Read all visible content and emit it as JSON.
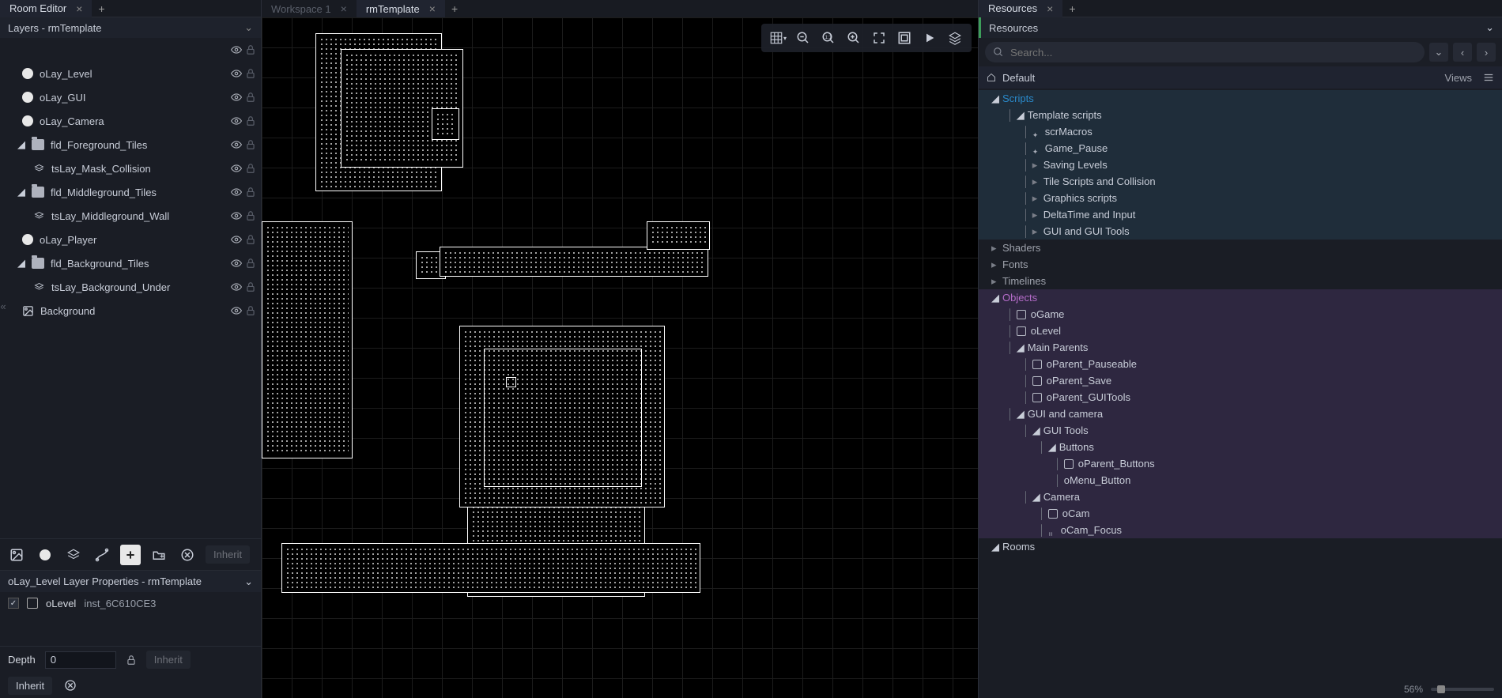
{
  "leftPanel": {
    "tab": "Room Editor",
    "layersHeader": "Layers - rmTemplate",
    "layers": [
      {
        "name": "",
        "type": "header-eye",
        "indent": 0
      },
      {
        "name": "oLay_Level",
        "type": "circle",
        "indent": 0
      },
      {
        "name": "oLay_GUI",
        "type": "circle",
        "indent": 0
      },
      {
        "name": "oLay_Camera",
        "type": "circle",
        "indent": 0
      },
      {
        "name": "fld_Foreground_Tiles",
        "type": "folder",
        "indent": 1,
        "open": true
      },
      {
        "name": "tsLay_Mask_Collision",
        "type": "tile",
        "indent": 2
      },
      {
        "name": "fld_Middleground_Tiles",
        "type": "folder",
        "indent": 1,
        "open": true
      },
      {
        "name": "tsLay_Middleground_Wall",
        "type": "tile",
        "indent": 2
      },
      {
        "name": "oLay_Player",
        "type": "circle",
        "indent": 0
      },
      {
        "name": "fld_Background_Tiles",
        "type": "folder",
        "indent": 1,
        "open": true
      },
      {
        "name": "tsLay_Background_Under",
        "type": "tile",
        "indent": 2
      },
      {
        "name": "Background",
        "type": "bg",
        "indent": 0
      }
    ],
    "inheritLabel": "Inherit",
    "propsHeader": "oLay_Level Layer Properties - rmTemplate",
    "instance": {
      "obj": "oLevel",
      "id": "inst_6C610CE3"
    },
    "depthLabel": "Depth",
    "depthValue": "0"
  },
  "center": {
    "tabs": [
      {
        "label": "Workspace 1",
        "active": false
      },
      {
        "label": "rmTemplate",
        "active": true
      }
    ]
  },
  "rightPanel": {
    "tab": "Resources",
    "header": "Resources",
    "searchPlaceholder": "Search...",
    "defaultLabel": "Default",
    "viewsLabel": "Views",
    "zoom": "56%",
    "tree": [
      {
        "t": "cat",
        "label": "Scripts",
        "cls": "scripts",
        "open": true,
        "indent": 0
      },
      {
        "t": "folder",
        "label": "Template scripts",
        "cls": "scripts",
        "open": true,
        "indent": 1
      },
      {
        "t": "script",
        "label": "scrMacros",
        "cls": "scripts",
        "indent": 2
      },
      {
        "t": "script",
        "label": "Game_Pause",
        "cls": "scripts",
        "indent": 2
      },
      {
        "t": "folder",
        "label": "Saving Levels",
        "cls": "scripts",
        "open": false,
        "indent": 2
      },
      {
        "t": "folder",
        "label": "Tile Scripts and Collision",
        "cls": "scripts",
        "open": false,
        "indent": 2
      },
      {
        "t": "folder",
        "label": "Graphics scripts",
        "cls": "scripts",
        "open": false,
        "indent": 2
      },
      {
        "t": "folder",
        "label": "DeltaTime and Input",
        "cls": "scripts",
        "open": false,
        "indent": 2
      },
      {
        "t": "folder",
        "label": "GUI and GUI Tools",
        "cls": "scripts",
        "open": false,
        "indent": 2,
        "last": true
      },
      {
        "t": "cat",
        "label": "Shaders",
        "cls": "plain",
        "open": false,
        "indent": 0
      },
      {
        "t": "cat",
        "label": "Fonts",
        "cls": "plain",
        "open": false,
        "indent": 0
      },
      {
        "t": "cat",
        "label": "Timelines",
        "cls": "plain",
        "open": false,
        "indent": 0
      },
      {
        "t": "cat",
        "label": "Objects",
        "cls": "objects",
        "open": true,
        "indent": 0
      },
      {
        "t": "obj",
        "label": "oGame",
        "cls": "objects",
        "indent": 1
      },
      {
        "t": "obj",
        "label": "oLevel",
        "cls": "objects",
        "indent": 1
      },
      {
        "t": "folder",
        "label": "Main Parents",
        "cls": "objects",
        "open": true,
        "indent": 1
      },
      {
        "t": "obj",
        "label": "oParent_Pauseable",
        "cls": "objects",
        "indent": 2
      },
      {
        "t": "obj",
        "label": "oParent_Save",
        "cls": "objects",
        "indent": 2
      },
      {
        "t": "obj",
        "label": "oParent_GUITools",
        "cls": "objects",
        "indent": 2,
        "last": true
      },
      {
        "t": "folder",
        "label": "GUI and camera",
        "cls": "objects",
        "open": true,
        "indent": 1
      },
      {
        "t": "folder",
        "label": "GUI Tools",
        "cls": "objects",
        "open": true,
        "indent": 2
      },
      {
        "t": "folder",
        "label": "Buttons",
        "cls": "objects",
        "open": true,
        "indent": 3
      },
      {
        "t": "obj",
        "label": "oParent_Buttons",
        "cls": "objects",
        "indent": 4
      },
      {
        "t": "leaf",
        "label": "oMenu_Button",
        "cls": "objects",
        "indent": 4,
        "last": true
      },
      {
        "t": "folder",
        "label": "Camera",
        "cls": "objects",
        "open": true,
        "indent": 2
      },
      {
        "t": "obj",
        "label": "oCam",
        "cls": "objects",
        "indent": 3
      },
      {
        "t": "dot",
        "label": "oCam_Focus",
        "cls": "objects",
        "indent": 3,
        "last": true
      },
      {
        "t": "cat",
        "label": "Rooms",
        "cls": "rooms",
        "open": true,
        "indent": 0
      }
    ]
  }
}
